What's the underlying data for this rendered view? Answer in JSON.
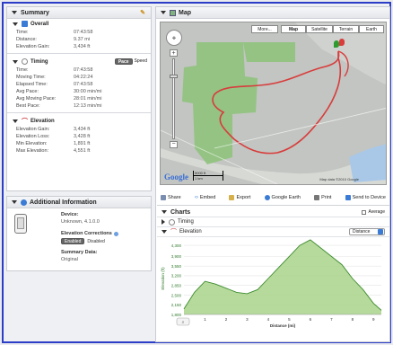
{
  "summary": {
    "title": "Summary",
    "overall": {
      "title": "Overall",
      "rows": [
        {
          "label": "Time:",
          "value": "07:43:58"
        },
        {
          "label": "Distance:",
          "value": "9.37 mi"
        },
        {
          "label": "Elevation Gain:",
          "value": "3,434 ft"
        }
      ]
    },
    "timing": {
      "title": "Timing",
      "toggle_pace": "Pace",
      "toggle_speed": "Speed",
      "rows": [
        {
          "label": "Time:",
          "value": "07:43:58"
        },
        {
          "label": "Moving Time:",
          "value": "04:22:24"
        },
        {
          "label": "Elapsed Time:",
          "value": "07:43:58"
        },
        {
          "label": "Avg Pace:",
          "value": "30:00 min/mi"
        },
        {
          "label": "Avg Moving Pace:",
          "value": "28:01 min/mi"
        },
        {
          "label": "Best Pace:",
          "value": "12:13 min/mi"
        }
      ]
    },
    "elevation": {
      "title": "Elevation",
      "rows": [
        {
          "label": "Elevation Gain:",
          "value": "3,434 ft"
        },
        {
          "label": "Elevation Loss:",
          "value": "3,428 ft"
        },
        {
          "label": "Min Elevation:",
          "value": "1,891 ft"
        },
        {
          "label": "Max Elevation:",
          "value": "4,551 ft"
        }
      ]
    }
  },
  "additional": {
    "title": "Additional Information",
    "device_label": "Device:",
    "device_value": "Unknown, 4.1.0.0",
    "corrections_label": "Elevation Corrections",
    "enabled": "Enabled",
    "disabled": "Disabled",
    "summary_data_label": "Summary Data:",
    "summary_data_value": "Original"
  },
  "map": {
    "title": "Map",
    "more": "More...",
    "types": [
      "Map",
      "Satellite",
      "Terrain",
      "Earth"
    ],
    "scale_top": "5000 ft",
    "scale_bottom": "1 km",
    "copyright": "Map data ©2010 Google",
    "google": "Google"
  },
  "toolbar": {
    "items": [
      "Share",
      "Embed",
      "Export",
      "Google Earth",
      "Print",
      "Send to Device"
    ]
  },
  "charts": {
    "title": "Charts",
    "average": "Average",
    "timing": "Timing",
    "elevation": "Elevation",
    "xaxis_select": "Distance",
    "ylabel": "Elevation (ft)",
    "xlabel": "Distance (mi)"
  },
  "chart_data": {
    "type": "area",
    "title": "",
    "xlabel": "Distance (mi)",
    "ylabel": "Elevation (ft)",
    "xlim": [
      0,
      9.37
    ],
    "ylim": [
      1800,
      4400
    ],
    "x_ticks": [
      1,
      2,
      3,
      4,
      5,
      6,
      7,
      8,
      9
    ],
    "y_ticks": [
      1800,
      2150,
      2500,
      2850,
      3200,
      3550,
      3900,
      4300
    ],
    "y_tick_labels": [
      "1,800",
      "2,150",
      "2,500",
      "2,850",
      "3,200",
      "3,550",
      "3,900",
      "4,300"
    ],
    "x": [
      0,
      0.5,
      1,
      1.5,
      2,
      2.5,
      3,
      3.5,
      4,
      4.5,
      5,
      5.5,
      6,
      6.5,
      7,
      7.5,
      8,
      8.5,
      9,
      9.37
    ],
    "series": [
      {
        "values": [
          2000,
          2600,
          3000,
          2900,
          2750,
          2600,
          2550,
          2700,
          3100,
          3500,
          3900,
          4300,
          4500,
          4200,
          3900,
          3600,
          3100,
          2700,
          2200,
          1950
        ]
      }
    ],
    "fill_color": "#a9d38a",
    "line_color": "#3d8b2f"
  }
}
